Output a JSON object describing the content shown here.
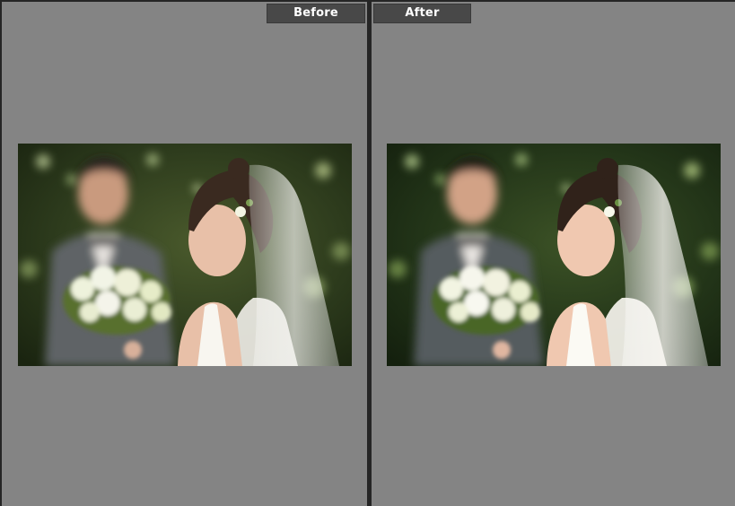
{
  "compare": {
    "before_label": "Before",
    "after_label": "After"
  },
  "photo": {
    "description_icon": "wedding-photo",
    "before_tone": {
      "background": "#2e3a1e",
      "foliage": "#4a5a2a",
      "skin": "#e8c0a8"
    },
    "after_tone": {
      "background": "#1e3018",
      "foliage": "#3a5226",
      "skin": "#f0c8b0"
    }
  },
  "colors": {
    "panel_bg": "#848484",
    "divider": "#252525",
    "label_bg": "#484848",
    "label_text": "#ffffff"
  }
}
